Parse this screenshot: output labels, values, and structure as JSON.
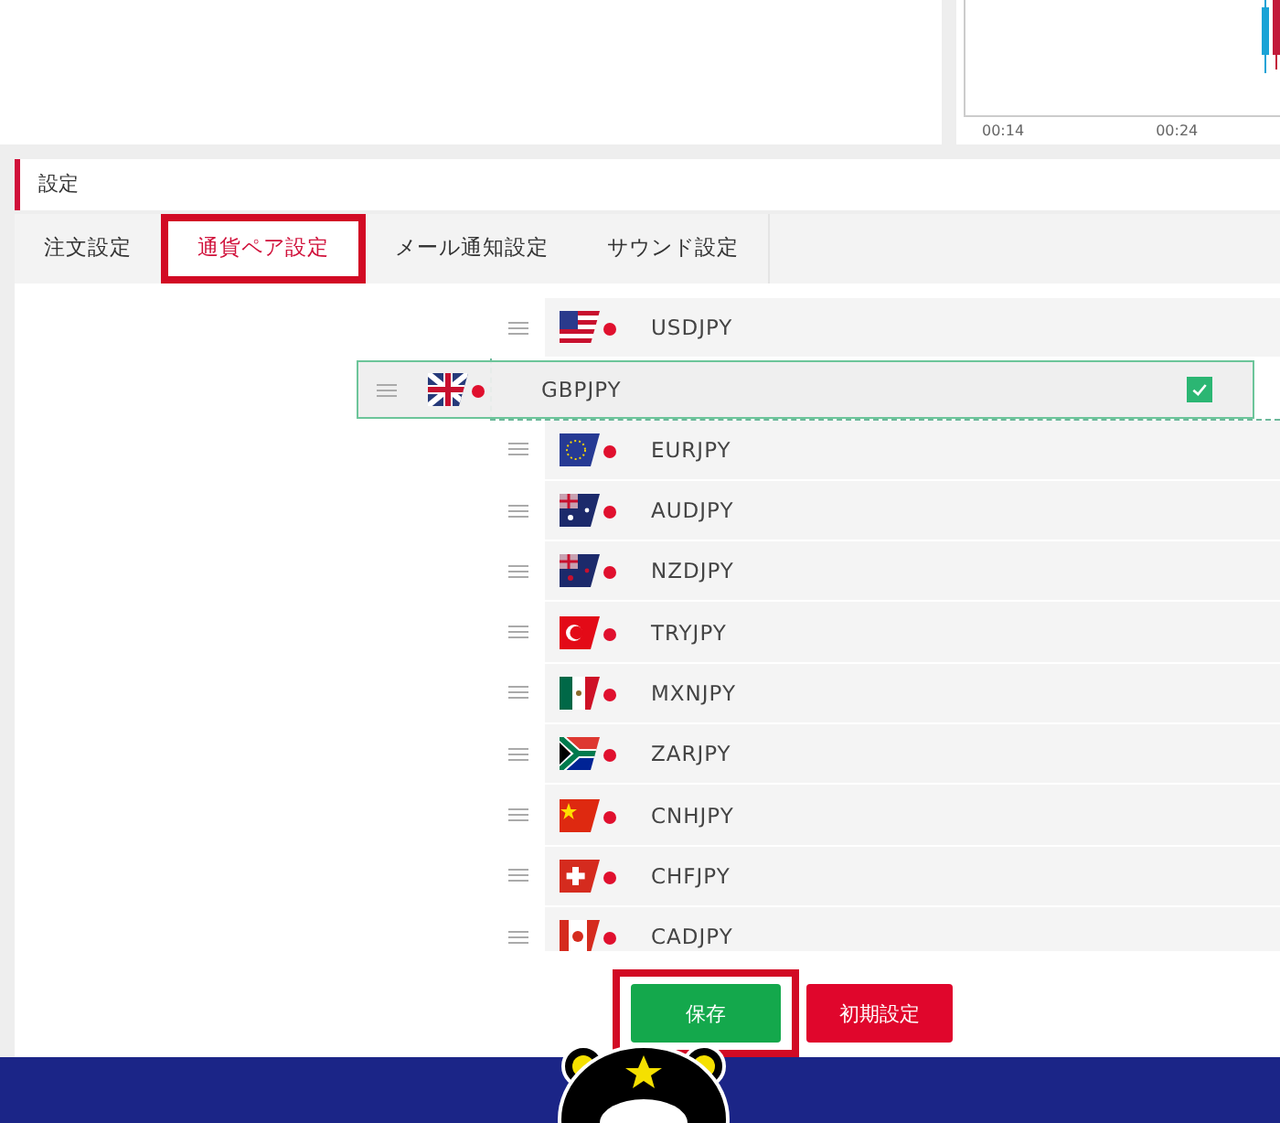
{
  "chart": {
    "x_labels": [
      "00:14",
      "00:24"
    ]
  },
  "section": {
    "title": "設定"
  },
  "tabs": [
    {
      "label": "注文設定",
      "selected": false,
      "highlighted": false
    },
    {
      "label": "通貨ペア設定",
      "selected": true,
      "highlighted": true
    },
    {
      "label": "メール通知設定",
      "selected": false,
      "highlighted": false
    },
    {
      "label": "サウンド設定",
      "selected": false,
      "highlighted": false
    }
  ],
  "pairs": [
    {
      "kind": "pair",
      "name": "USDJPY"
    },
    {
      "kind": "drop_slot"
    },
    {
      "kind": "pair",
      "name": "EURJPY"
    },
    {
      "kind": "pair",
      "name": "AUDJPY"
    },
    {
      "kind": "pair",
      "name": "NZDJPY"
    },
    {
      "kind": "pair",
      "name": "TRYJPY"
    },
    {
      "kind": "pair",
      "name": "MXNJPY"
    },
    {
      "kind": "pair",
      "name": "ZARJPY"
    },
    {
      "kind": "pair",
      "name": "CNHJPY"
    },
    {
      "kind": "pair",
      "name": "CHFJPY"
    },
    {
      "kind": "pair",
      "name": "CADJPY"
    }
  ],
  "dragging": {
    "name": "GBPJPY",
    "checked": true
  },
  "buttons": [
    {
      "kind": "save",
      "label": "保存",
      "highlighted": true
    },
    {
      "kind": "reset",
      "label": "初期設定",
      "highlighted": false
    }
  ]
}
